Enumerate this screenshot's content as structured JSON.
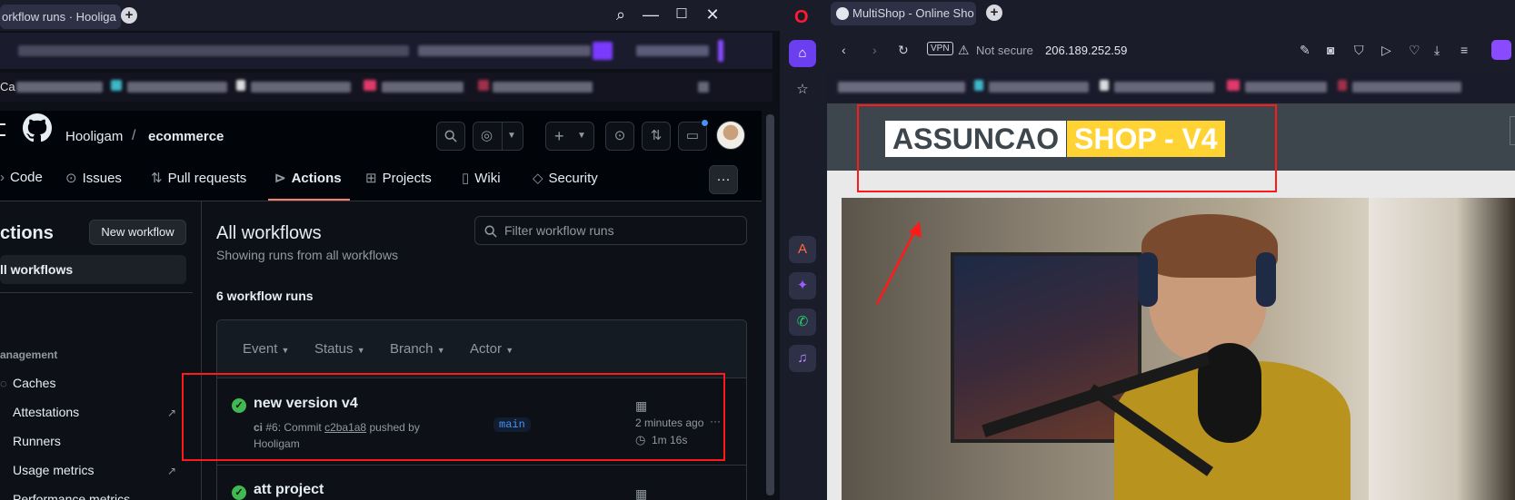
{
  "left_browser": {
    "tab_title": "orkflow runs · Hooliga",
    "tab_close": "×",
    "new_tab": "+",
    "window_controls": {
      "search": "⌕",
      "minimize": "—",
      "maximize": "☐",
      "close": "✕"
    },
    "bookmark_partial": "Ca"
  },
  "github": {
    "owner": "Hooligam",
    "separator": "/",
    "repo": "ecommerce",
    "nav": [
      {
        "label": "Code",
        "icon": "code-icon"
      },
      {
        "label": "Issues",
        "icon": "issue-icon"
      },
      {
        "label": "Pull requests",
        "icon": "pull-request-icon"
      },
      {
        "label": "Actions",
        "icon": "play-icon"
      },
      {
        "label": "Projects",
        "icon": "table-icon"
      },
      {
        "label": "Wiki",
        "icon": "book-icon"
      },
      {
        "label": "Security",
        "icon": "shield-icon"
      }
    ],
    "more": "···",
    "sidebar": {
      "title": "ctions",
      "new_workflow": "New workflow",
      "all_workflows": "ll workflows",
      "section": "anagement",
      "items": [
        "Caches",
        "Attestations",
        "Runners",
        "Usage metrics",
        "Performance metrics"
      ],
      "ext": "↗"
    },
    "main": {
      "title": "All workflows",
      "subtitle": "Showing runs from all workflows",
      "filter_placeholder": "Filter workflow runs",
      "count": "6 workflow runs",
      "filters": [
        "Event",
        "Status",
        "Branch",
        "Actor"
      ],
      "runs": [
        {
          "title": "new version v4",
          "workflow": "ci",
          "detail_pre": "#6: Commit",
          "commit": "c2ba1a8",
          "detail_post": "pushed by",
          "author": "Hooligam",
          "branch": "main",
          "time": "2 minutes ago",
          "duration": "1m 16s",
          "menu": "···"
        },
        {
          "title": "att project"
        }
      ]
    }
  },
  "right_browser": {
    "tab_title": "MultiShop - Online Sho",
    "new_tab": "+",
    "vpn": "VPN",
    "security": "Not secure",
    "url": "206.189.252.59",
    "page": {
      "logo_part1": "ASSUNCAO",
      "logo_part2": "SHOP - V4"
    }
  },
  "colors": {
    "annotation": "#ff1a1a",
    "gh_accent": "#f78166",
    "success": "#3fb950",
    "logo_yellow": "#ffd333"
  }
}
